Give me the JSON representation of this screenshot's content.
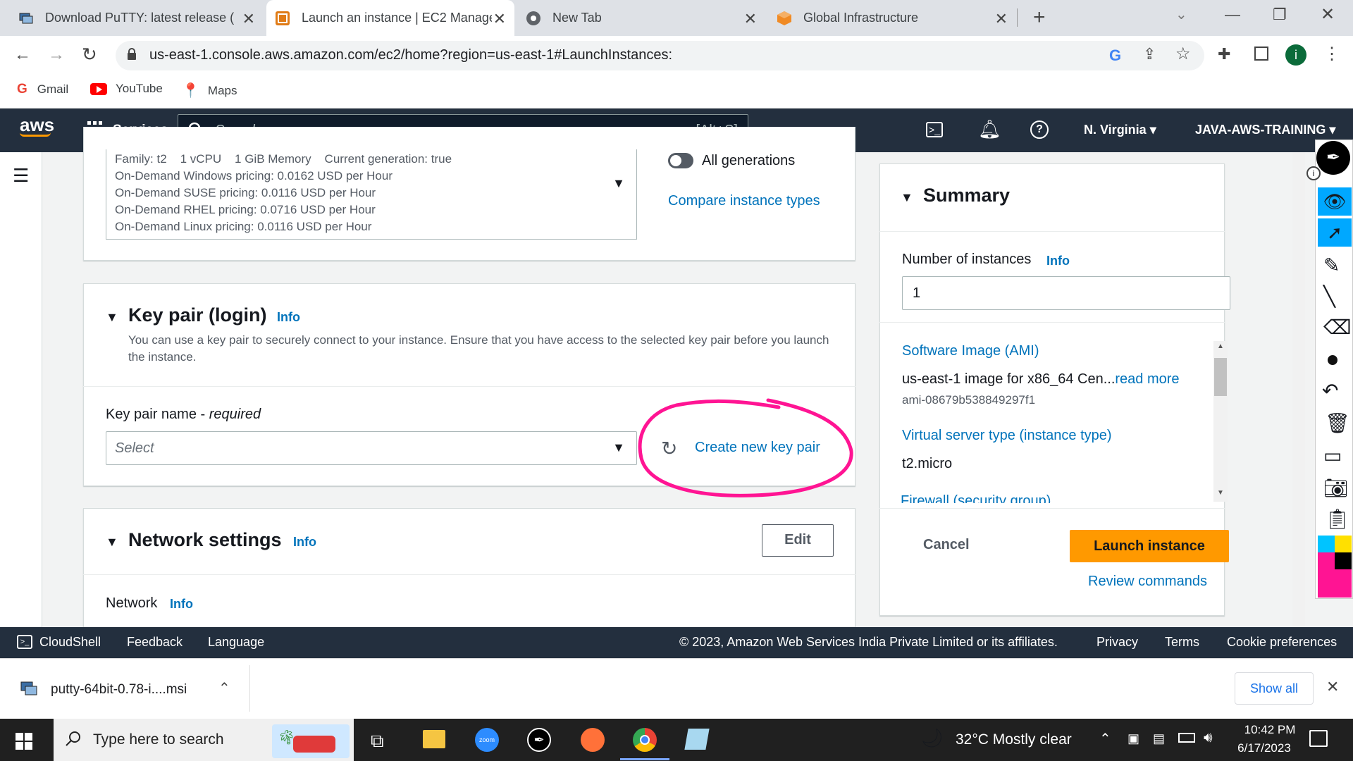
{
  "tabs": [
    {
      "title": "Download PuTTY: latest release (",
      "icon": "putty-icon"
    },
    {
      "title": "Launch an instance | EC2 Manage",
      "icon": "aws-icon"
    },
    {
      "title": "New Tab",
      "icon": "chrome-icon"
    },
    {
      "title": "Global Infrastructure",
      "icon": "aws-box-icon"
    }
  ],
  "url": "us-east-1.console.aws.amazon.com/ec2/home?region=us-east-1#LaunchInstances:",
  "profile_initial": "i",
  "bookmarks": [
    "Gmail",
    "YouTube",
    "Maps"
  ],
  "aws": {
    "logo": "aws",
    "services": "Services",
    "search_placeholder": "Search",
    "shortcut": "[Alt+S]",
    "region": "N. Virginia",
    "account": "JAVA-AWS-TRAINING"
  },
  "instance_type": {
    "lines": [
      "Family: t2    1 vCPU    1 GiB Memory    Current generation: true",
      "On-Demand Windows pricing: 0.0162 USD per Hour",
      "On-Demand SUSE pricing: 0.0116 USD per Hour",
      "On-Demand RHEL pricing: 0.0716 USD per Hour",
      "On-Demand Linux pricing: 0.0116 USD per Hour"
    ],
    "all_generations": "All generations",
    "compare": "Compare instance types"
  },
  "key_pair": {
    "title": "Key pair (login)",
    "info": "Info",
    "desc": "You can use a key pair to securely connect to your instance. Ensure that you have access to the selected key pair before you launch the instance.",
    "label": "Key pair name - ",
    "required": "required",
    "select_placeholder": "Select",
    "create": "Create new key pair"
  },
  "network": {
    "title": "Network settings",
    "info": "Info",
    "edit": "Edit",
    "network_label": "Network",
    "network_info": "Info"
  },
  "summary": {
    "title": "Summary",
    "num_label": "Number of instances",
    "num_info": "Info",
    "num_value": "1",
    "ami_title": "Software Image (AMI)",
    "ami_text": "us-east-1 image for x86_64 Cen...",
    "read_more": "read more",
    "ami_id": "ami-08679b538849297f1",
    "vtype_title": "Virtual server type (instance type)",
    "vtype_value": "t2.micro",
    "firewall_title": "Firewall (security group)",
    "cancel": "Cancel",
    "launch": "Launch instance",
    "review": "Review commands"
  },
  "footer": {
    "cloudshell": "CloudShell",
    "feedback": "Feedback",
    "language": "Language",
    "copyright": "© 2023, Amazon Web Services India Private Limited or its affiliates.",
    "privacy": "Privacy",
    "terms": "Terms",
    "cookie": "Cookie preferences"
  },
  "download": {
    "file": "putty-64bit-0.78-i....msi",
    "show_all": "Show all"
  },
  "taskbar": {
    "search": "Type here to search",
    "weather": "32°C  Mostly clear",
    "time": "10:42 PM",
    "date": "6/17/2023"
  },
  "colors": {
    "aws_nav": "#232f3e",
    "link": "#0073bb",
    "launch": "#ff9900",
    "annotation": "#ff1493"
  }
}
